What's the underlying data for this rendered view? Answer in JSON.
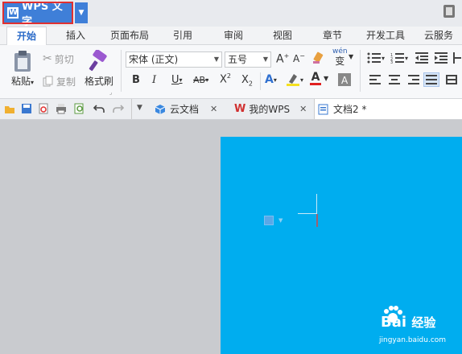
{
  "app": {
    "title": "WPS 文字",
    "logo_letter": "W"
  },
  "tabs": [
    {
      "label": "开始",
      "active": true
    },
    {
      "label": "插入"
    },
    {
      "label": "页面布局"
    },
    {
      "label": "引用"
    },
    {
      "label": "审阅"
    },
    {
      "label": "视图"
    },
    {
      "label": "章节"
    },
    {
      "label": "开发工具"
    },
    {
      "label": "云服务"
    }
  ],
  "ribbon": {
    "paste_label": "粘贴",
    "cut_label": "剪切",
    "copy_label": "复制",
    "format_painter_label": "格式刷",
    "font_name": "宋体 (正文)",
    "font_size": "五号",
    "wen_label": "变",
    "accent": "#2a6ac8"
  },
  "doc_tabs": [
    {
      "label": "云文档"
    },
    {
      "label": "我的WPS"
    },
    {
      "label": "文档2 *"
    }
  ],
  "page": {
    "color": "#00adef"
  },
  "watermark": {
    "brand": "Bai",
    "brand2": "经验",
    "url": "jingyan.baidu.com"
  }
}
